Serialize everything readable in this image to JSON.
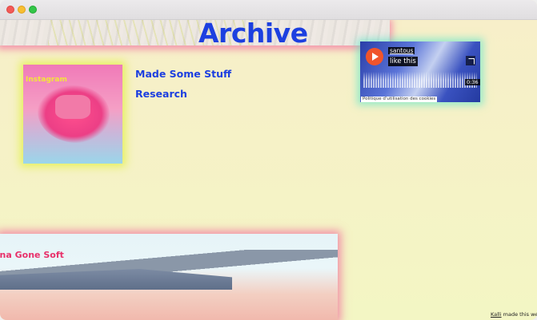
{
  "header": {
    "title": "Archive"
  },
  "instagram": {
    "label": "Instagram"
  },
  "nav": {
    "items": [
      {
        "label": "Made Some Stuff"
      },
      {
        "label": "Research"
      }
    ]
  },
  "soundcloud": {
    "user": "santous",
    "track": "like this",
    "duration": "0:36",
    "cookie_notice": "Politique d'utilisation des cookies"
  },
  "project": {
    "title": "ona Gone Soft"
  },
  "footer": {
    "credit_link": "Kalli",
    "credit_text": "made this websi"
  },
  "colors": {
    "accent_blue": "#1c3fe0",
    "accent_pink": "#e8306a",
    "background": "#f7f3c8",
    "glow_pink": "#f050a0",
    "glow_yellow": "#e1f03c",
    "soundcloud_orange": "#f0542b"
  }
}
